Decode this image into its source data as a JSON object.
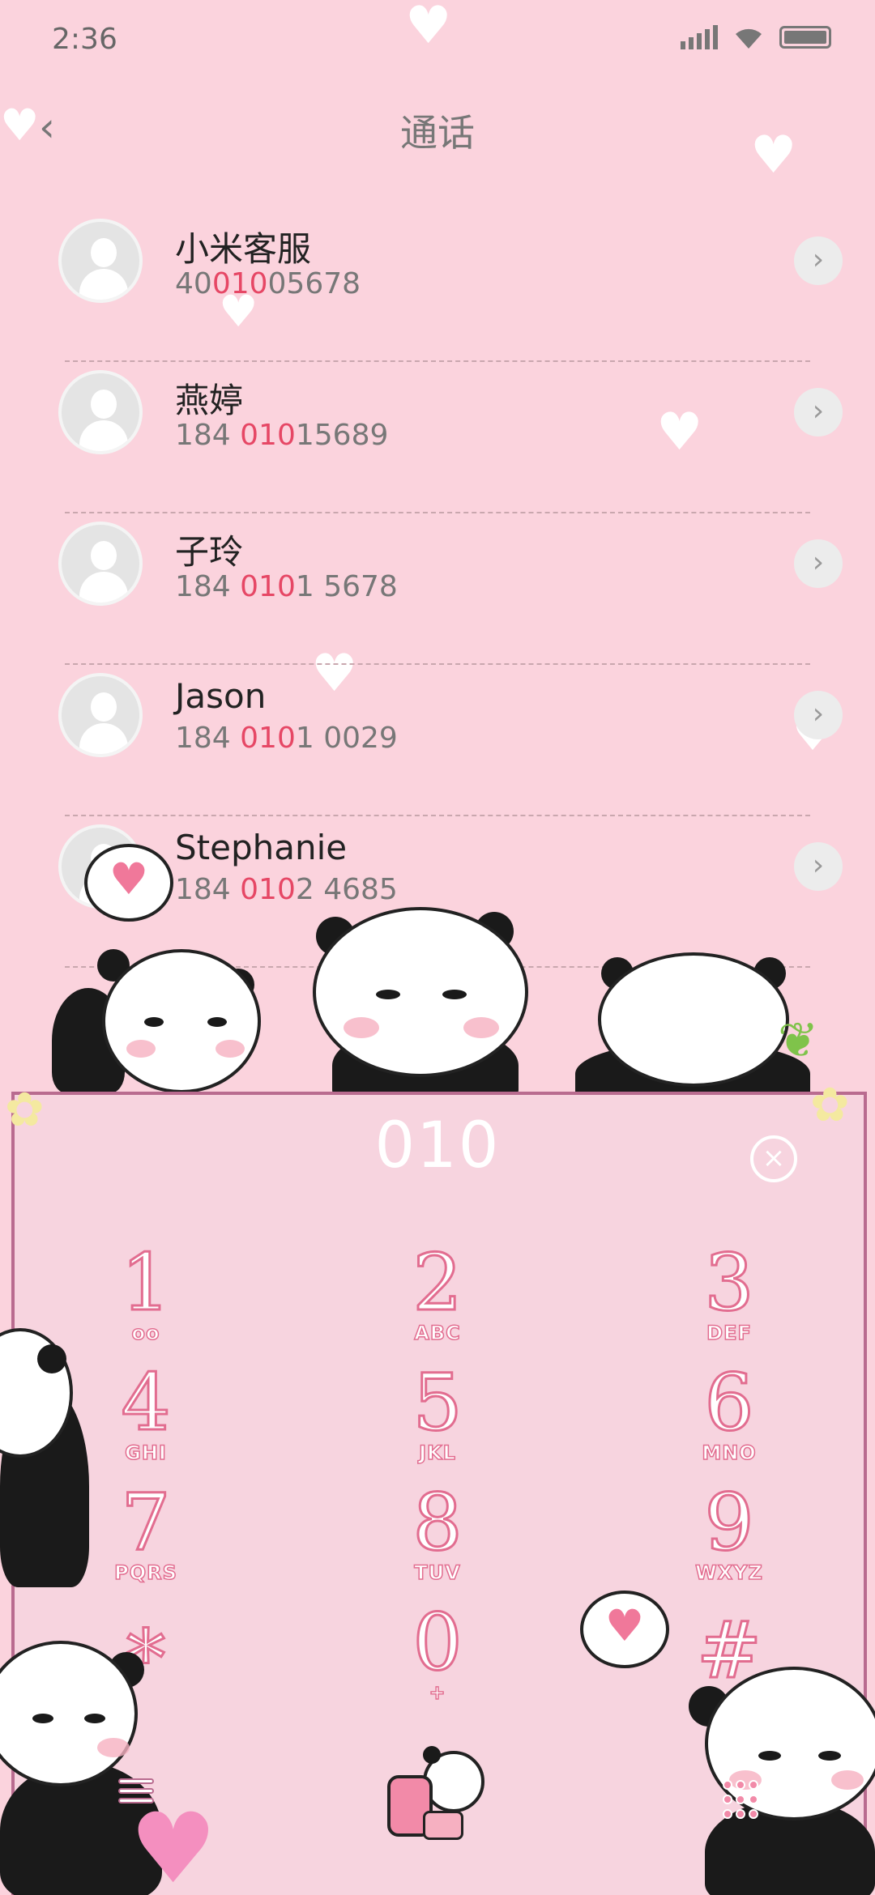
{
  "status_bar": {
    "time": "2:36"
  },
  "header": {
    "back_label": "‹",
    "title": "通话"
  },
  "contacts": [
    {
      "name": "小米客服",
      "num_pre": "40",
      "num_hl": "010",
      "num_post": "05678"
    },
    {
      "name": "燕婷",
      "num_pre": "184 ",
      "num_hl": "010",
      "num_post": "15689"
    },
    {
      "name": "子玲",
      "num_pre": "184 ",
      "num_hl": "010",
      "num_post": "1 5678"
    },
    {
      "name": "Jason",
      "num_pre": "184 ",
      "num_hl": "010",
      "num_post": "1 0029"
    },
    {
      "name": "Stephanie",
      "num_pre": "184 ",
      "num_hl": "010",
      "num_post": "2 4685"
    }
  ],
  "dialer": {
    "input": "010",
    "clear_label": "×",
    "keys": [
      {
        "digit": "1",
        "letters": "oo"
      },
      {
        "digit": "2",
        "letters": "ABC"
      },
      {
        "digit": "3",
        "letters": "DEF"
      },
      {
        "digit": "4",
        "letters": "GHI"
      },
      {
        "digit": "5",
        "letters": "JKL"
      },
      {
        "digit": "6",
        "letters": "MNO"
      },
      {
        "digit": "7",
        "letters": "PQRS"
      },
      {
        "digit": "8",
        "letters": "TUV"
      },
      {
        "digit": "9",
        "letters": "WXYZ"
      },
      {
        "digit": "*",
        "letters": ""
      },
      {
        "digit": "0",
        "letters": "+"
      },
      {
        "digit": "#",
        "letters": ""
      }
    ]
  },
  "icons": {
    "back": "chevron-left-icon",
    "row_action": "chevron-right-icon",
    "clear": "close-circle-icon",
    "menu": "menu-icon",
    "keypad": "keypad-icon",
    "call": "panda-phone-call-icon"
  },
  "colors": {
    "background": "#fbd3dd",
    "highlight": "#e64765",
    "board": "#f7d4df",
    "digit_stroke": "#e26d90"
  }
}
